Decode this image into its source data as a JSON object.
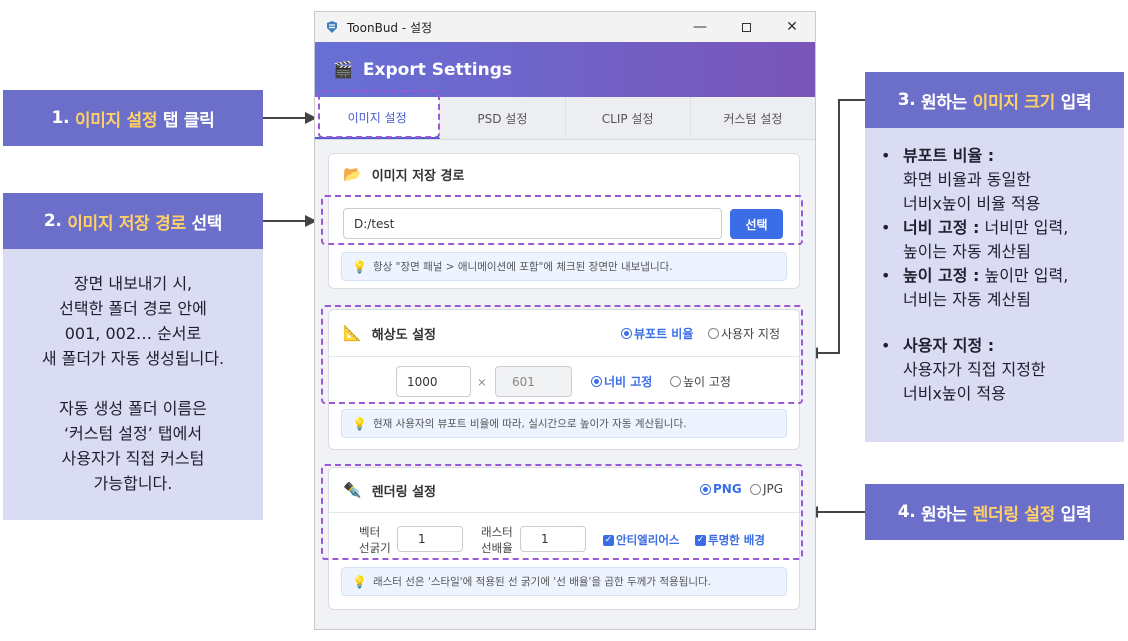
{
  "window": {
    "title": "ToonBud - 설정",
    "header_title": "Export Settings",
    "tabs": [
      {
        "label": "이미지 설정",
        "active": true
      },
      {
        "label": "PSD 설정",
        "active": false
      },
      {
        "label": "CLIP 설정",
        "active": false
      },
      {
        "label": "커스텀 설정",
        "active": false
      }
    ]
  },
  "save_path": {
    "title": "이미지 저장 경로",
    "value": "D:/test",
    "select_button": "선택",
    "tip": "항상 \"장면 패널 > 애니메이션에 포함\"에 체크된 장면만 내보냅니다."
  },
  "resolution": {
    "title": "해상도 설정",
    "ratio_viewport": "뷰포트 비율",
    "ratio_custom": "사용자 지정",
    "width": "1000",
    "times": "×",
    "height": "601",
    "fix_width": "너비 고정",
    "fix_height": "높이 고정",
    "tip": "현재 사용자의 뷰포트 비율에 따라, 실시간으로 높이가 자동 계산됩니다."
  },
  "rendering": {
    "title": "렌더링 설정",
    "format_png": "PNG",
    "format_jpg": "JPG",
    "vector_label_1": "벡터",
    "vector_label_2": "선굵기",
    "vector_value": "1",
    "raster_label_1": "래스터",
    "raster_label_2": "선배율",
    "raster_value": "1",
    "antialias": "안티엘리어스",
    "transparent": "투명한 배경",
    "tip": "래스터 선은 '스타일'에 적용된 선 굵기에 '선 배율'을 곱한 두께가 적용됩니다."
  },
  "annotations": {
    "a1": {
      "num": "1.",
      "hl": "이미지 설정",
      "rest": "탭 클릭"
    },
    "a2": {
      "num": "2.",
      "hl": "이미지 저장 경로",
      "rest": "선택"
    },
    "a2_body": [
      "장면 내보내기 시,",
      "선택한 폴더 경로 안에",
      "001, 002… 순서로",
      "새 폴더가 자동 생성됩니다.",
      "",
      "자동 생성 폴더 이름은",
      "‘커스텀 설정’ 탭에서",
      "사용자가 직접 커스텀",
      "가능합니다."
    ],
    "a3": {
      "num": "3.",
      "pre": "원하는",
      "hl": "이미지 크기",
      "rest": "입력"
    },
    "a3_items": [
      {
        "bold": "뷰포트 비율 :",
        "text": [
          "화면 비율과 동일한",
          "너비x높이 비율 적용"
        ]
      },
      {
        "bold": "너비 고정 :",
        "inline": "너비만 입력,",
        "text": [
          "높이는 자동 계산됨"
        ]
      },
      {
        "bold": "높이 고정 :",
        "inline": "높이만 입력,",
        "text": [
          "너비는 자동 계산됨"
        ]
      },
      {
        "bold": "사용자 지정 :",
        "text": [
          "사용자가 직접 지정한",
          "너비x높이 적용"
        ]
      }
    ],
    "a4": {
      "num": "4.",
      "pre": "원하는",
      "hl": "렌더링 설정",
      "rest": "입력"
    }
  },
  "colors": {
    "accent": "#3b6ee6",
    "callout": "#6b6fc9",
    "highlight": "#ffd166",
    "dash": "#9a59d6"
  }
}
